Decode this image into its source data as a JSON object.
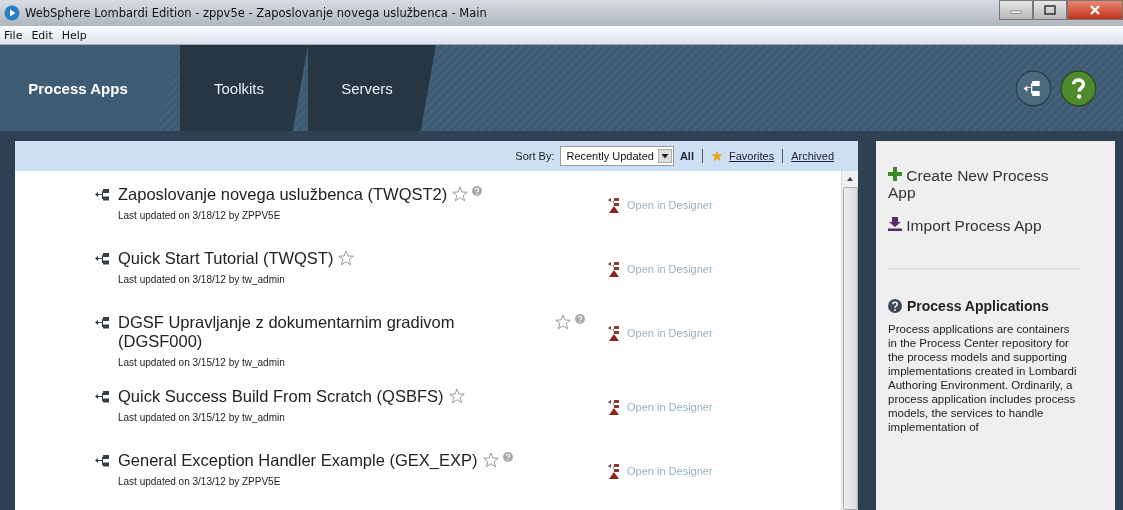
{
  "window": {
    "title": "WebSphere Lombardi Edition -  zppv5e - Zaposlovanje novega uslužbenca - Main"
  },
  "menu": [
    "File",
    "Edit",
    "Help"
  ],
  "tabs": [
    {
      "label": "Process Apps",
      "selected": true
    },
    {
      "label": "Toolkits",
      "selected": false
    },
    {
      "label": "Servers",
      "selected": false
    }
  ],
  "filter_bar": {
    "sort_label": "Sort By:",
    "sort_value": "Recently Updated",
    "filters": [
      {
        "label": "All",
        "selected": true,
        "kind": "plain"
      },
      {
        "label": "Favorites",
        "selected": false,
        "kind": "favorites"
      },
      {
        "label": "Archived",
        "selected": false,
        "kind": "plain"
      }
    ]
  },
  "apps": [
    {
      "title": "Zaposlovanje novega uslužbenca (TWQST2)",
      "updated": "Last updated on 3/18/12 by ZPPV5E",
      "favorite": false,
      "has_info": true,
      "action": "Open in Designer"
    },
    {
      "title": "Quick Start Tutorial (TWQST)",
      "updated": "Last updated on 3/18/12 by tw_admin",
      "favorite": false,
      "has_info": false,
      "action": "Open in Designer"
    },
    {
      "title": "DGSF Upravljanje z dokumentarnim gradivom (DGSF000)",
      "updated": "Last updated on 3/15/12 by tw_admin",
      "favorite": false,
      "has_info": true,
      "action": "Open in Designer"
    },
    {
      "title": "Quick Success Build From Scratch (QSBFS)",
      "updated": "Last updated on 3/15/12 by tw_admin",
      "favorite": false,
      "has_info": false,
      "action": "Open in Designer"
    },
    {
      "title": "General Exception Handler Example (GEX_EXP)",
      "updated": "Last updated on 3/13/12 by ZPPV5E",
      "favorite": false,
      "has_info": true,
      "action": "Open in Designer"
    }
  ],
  "side_panel": {
    "actions": [
      {
        "label": "Create New Process App",
        "kind": "create"
      },
      {
        "label": "Import Process App",
        "kind": "import"
      }
    ],
    "help_title": "Process Applications",
    "help_text": "Process applications are containers in the Process Center repository for the process models and supporting implementations created in Lombardi Authoring Environment. Ordinarily, a process application includes process models, the services to handle implementation of"
  }
}
